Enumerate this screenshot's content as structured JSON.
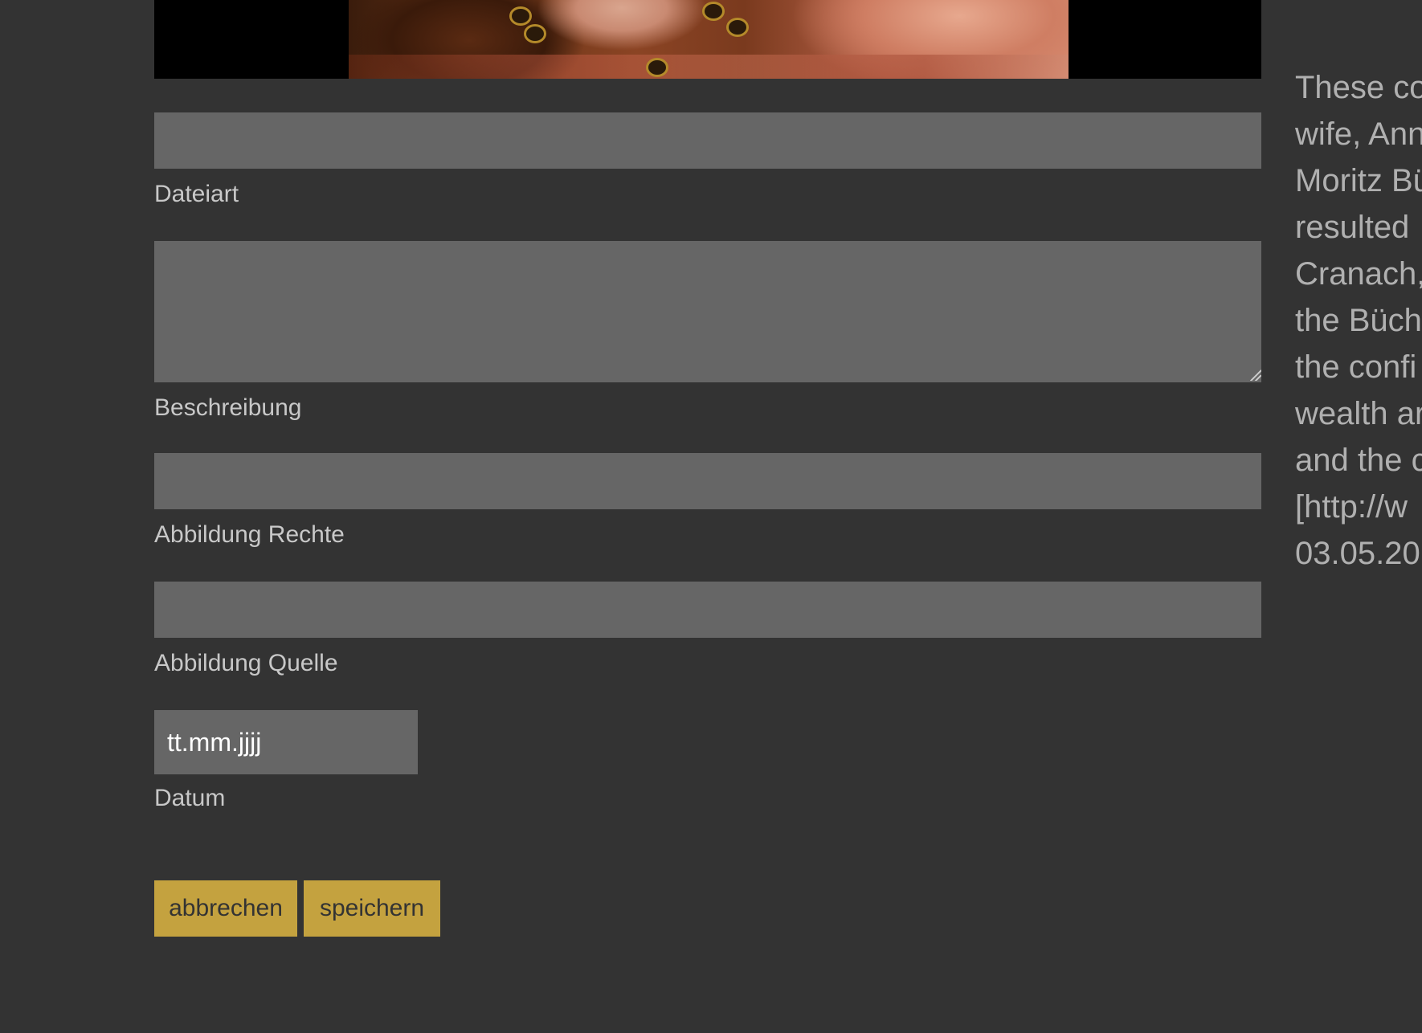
{
  "form": {
    "fields": {
      "dateiart": {
        "label": "Dateiart",
        "value": ""
      },
      "beschreibung": {
        "label": "Beschreibung",
        "value": ""
      },
      "abbildung_rechte": {
        "label": "Abbildung Rechte",
        "value": ""
      },
      "abbildung_quelle": {
        "label": "Abbildung Quelle",
        "value": ""
      },
      "datum": {
        "label": "Datum",
        "placeholder": "tt.mm.jjjj"
      }
    },
    "buttons": {
      "cancel": "abbrechen",
      "save": "speichern"
    }
  },
  "side_text": {
    "lines": [
      "These co",
      "wife, Ann",
      "Moritz Bü",
      "resulted",
      "Cranach,",
      "the Büch",
      "the confi",
      "wealth ar",
      "and the c",
      "[http://w",
      "03.05.20"
    ]
  },
  "colors": {
    "background": "#333333",
    "input_background": "#666666",
    "button_accent": "#c4a23f",
    "label_text": "#c8c8c8"
  }
}
